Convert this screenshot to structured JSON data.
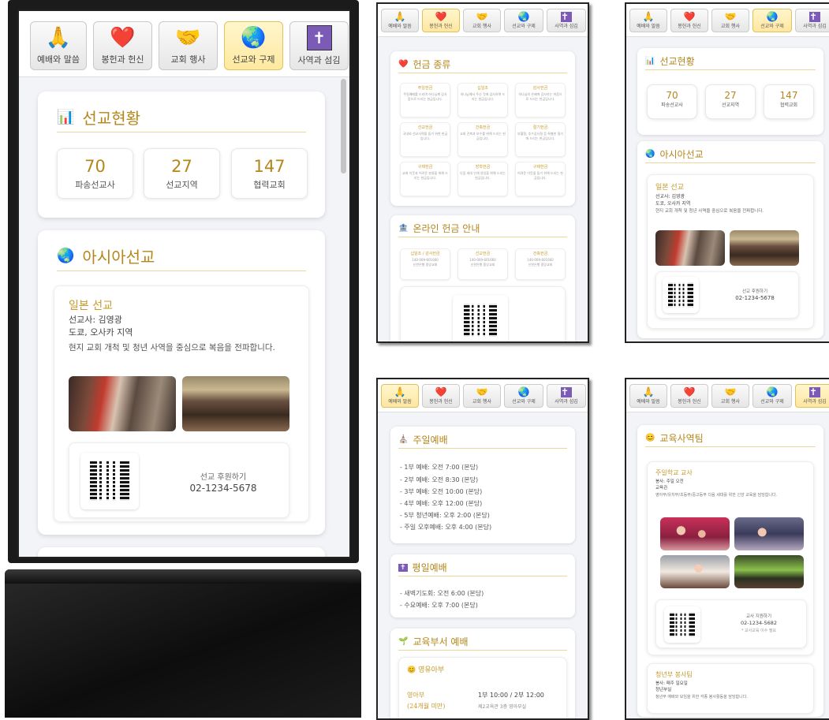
{
  "tabs": [
    {
      "label": "예배와 말씀",
      "icon": "praying-hands-icon"
    },
    {
      "label": "봉헌과 헌신",
      "icon": "heart-icon"
    },
    {
      "label": "교회 행사",
      "icon": "handshake-icon"
    },
    {
      "label": "선교와 구제",
      "icon": "globe-icon"
    },
    {
      "label": "사역과 섬김",
      "icon": "cross-icon"
    }
  ],
  "main": {
    "status_title": "선교현황",
    "stats": [
      {
        "value": "70",
        "label": "파송선교사"
      },
      {
        "value": "27",
        "label": "선교지역"
      },
      {
        "value": "147",
        "label": "협력교회"
      }
    ],
    "asia_title": "아시아선교",
    "mission": {
      "title": "일본 선교",
      "missionary": "선교사: 김영광",
      "region": "도쿄, 오사카 지역",
      "desc": "현지 교회 개척 및 청년 사역을 중심으로 복음을 전파합니다.",
      "support_label": "선교 후원하기",
      "phone": "02-1234-5678"
    }
  },
  "offering": {
    "title": "헌금 종류",
    "items": [
      {
        "name": "주일헌금",
        "desc": "주일예배를 드리며 하나님께 감사함으로 드리는 헌금입니다."
      },
      {
        "name": "십일조",
        "desc": "하나님께서 주신 것에 감사하며 드리는 헌금입니다."
      },
      {
        "name": "감사헌금",
        "desc": "하나님의 은혜에 감사하는 마음으로 드리는 헌금입니다."
      },
      {
        "name": "선교헌금",
        "desc": "국내외 선교사역을 돕기 위한 헌금입니다."
      },
      {
        "name": "건축헌금",
        "desc": "교회 건축과 보수를 위해 드리는 헌금입니다."
      },
      {
        "name": "절기헌금",
        "desc": "부활절, 추수감사절 등 특별한 절기에 드리는 헌금입니다."
      },
      {
        "name": "구제헌금",
        "desc": "교회 이웃과 어려운 분들을 위해 드리는 헌금입니다."
      },
      {
        "name": "장학헌금",
        "desc": "다음 세대 인재 양성을 위해 드리는 헌금입니다."
      },
      {
        "name": "구제헌금",
        "desc": "어려운 이웃을 돕기 위해 드리는 헌금입니다."
      }
    ],
    "online_title": "온라인 헌금 안내",
    "accounts": [
      {
        "name": "십일조 / 감사헌금",
        "number": "140-009-601660",
        "bank": "신한은행 중앙교회"
      },
      {
        "name": "선교헌금",
        "number": "140-009-601660",
        "bank": "신한은행 중앙교회"
      },
      {
        "name": "건축헌금",
        "number": "140-009-601660",
        "bank": "신한은행 중앙교회"
      }
    ]
  },
  "mission_small": {
    "title": "선교현황",
    "stats": [
      {
        "value": "70",
        "label": "파송선교사"
      },
      {
        "value": "27",
        "label": "선교지역"
      },
      {
        "value": "147",
        "label": "협력교회"
      }
    ],
    "asia_title": "아시아선교",
    "mission_title": "일본 선교",
    "missionary": "선교사: 김영광",
    "region": "도쿄, 오사카 지역",
    "desc": "현지 교회 개척 및 청년 사역을 중심으로 복음을 전파합니다.",
    "support_label": "선교 후원하기",
    "phone": "02-1234-5678"
  },
  "worship": {
    "sunday_title": "주일예배",
    "sunday": [
      "- 1부 예배: 오전 7:00 (본당)",
      "- 2부 예배: 오전 8:30 (본당)",
      "- 3부 예배: 오전 10:00 (본당)",
      "- 4부 예배: 오후 12:00 (본당)",
      "- 5부 청년예배: 오후 2:00 (본당)",
      "- 주일 오후예배: 오후 4:00 (본당)"
    ],
    "weekday_title": "평일예배",
    "weekday": [
      "- 새벽기도회: 오전 6:00 (본당)",
      "- 수요예배: 오후 7:00 (본당)"
    ],
    "edu_title": "교육부서 예배",
    "infant_title": "영유아부",
    "infant_label": "영아부",
    "infant_age": "(24개월 미만)",
    "infant_time": "1부 10:00 / 2부 12:00",
    "infant_place": "제2교육관 3층 영아부실"
  },
  "ministry": {
    "title": "교육사역팀",
    "team1_title": "주일학교 교사",
    "team1_time": "봉사: 주일 오전",
    "team1_dept": "교육관",
    "team1_desc": "영아부/유치부/초등부/중고등부 다음 세대를 위한 신앙 교육을 담당합니다.",
    "apply_label": "교사 지원하기",
    "apply_phone": "02-1234-5682",
    "apply_note": "* 교사교육 이수 필요",
    "team2_title": "청년부 봉사팀",
    "team2_time": "봉사: 매주 일요일",
    "team2_dept": "청년부실",
    "team2_desc": "청년부 예배와 모임을 위한 각종 봉사활동을 담당합니다."
  },
  "colors": {
    "accent": "#b5861b",
    "active_tab": "#ffe9a0"
  }
}
